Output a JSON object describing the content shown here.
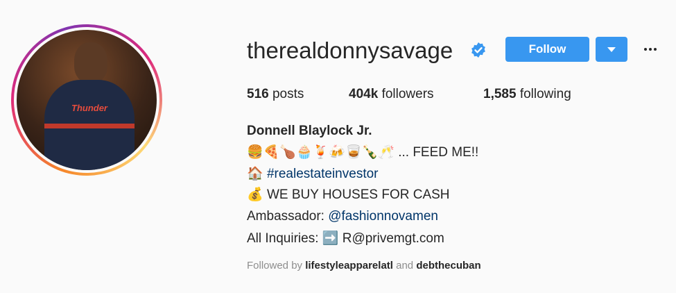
{
  "profile": {
    "username": "therealdonnysavage",
    "verified": true,
    "follow_label": "Follow",
    "stats": {
      "posts_count": "516",
      "posts_label": "posts",
      "followers_count": "404k",
      "followers_label": "followers",
      "following_count": "1,585",
      "following_label": "following"
    },
    "full_name": "Donnell Blaylock Jr.",
    "bio": {
      "line1_emojis": "🍔🍕🍗🧁🍹🍻🥃🍾🥂",
      "line1_text": "... FEED ME!!",
      "line2_emoji": "🏠",
      "line2_hashtag": "#realestateinvestor",
      "line3_emoji": "💰",
      "line3_text": "WE BUY HOUSES FOR CASH",
      "line4_prefix": "Ambassador:",
      "line4_mention": "@fashionnovamen",
      "line5_prefix": "All Inquiries:",
      "line5_emoji": "➡️",
      "line5_text": "R@privemgt.com"
    },
    "followed_by": {
      "prefix": "Followed by",
      "user1": "lifestyleapparelatl",
      "conjunction": "and",
      "user2": "debthecuban"
    },
    "photo_jersey_text": "Thunder"
  },
  "colors": {
    "accent": "#3897f0",
    "link": "#003569",
    "muted": "#8e8e8e",
    "text": "#262626"
  }
}
